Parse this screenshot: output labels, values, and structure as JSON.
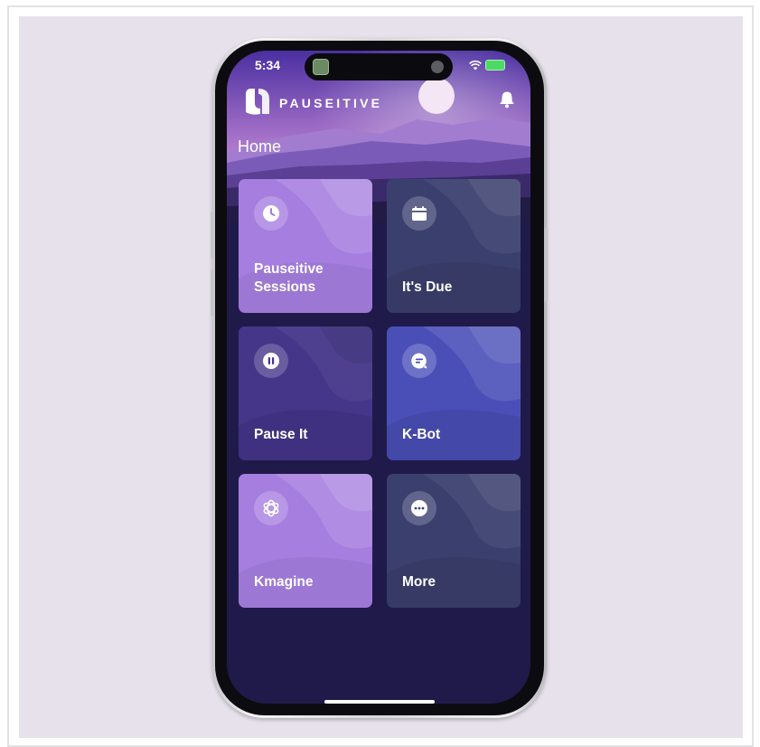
{
  "status": {
    "time": "5:34"
  },
  "header": {
    "brand": "PAUSEITIVE",
    "title": "Home"
  },
  "tiles": [
    {
      "label": "Pauseitive Sessions",
      "icon": "clock-icon",
      "color": "#a57ee0"
    },
    {
      "label": "It's Due",
      "icon": "calendar-icon",
      "color": "#3b3f6e"
    },
    {
      "label": "Pause It",
      "icon": "pause-icon",
      "color": "#45368a"
    },
    {
      "label": "K-Bot",
      "icon": "chat-icon",
      "color": "#4a4fb8"
    },
    {
      "label": "Kmagine",
      "icon": "openai-icon",
      "color": "#a57ee0"
    },
    {
      "label": "More",
      "icon": "more-icon",
      "color": "#3b3f6e"
    }
  ],
  "colors": {
    "screen_bg": "#201a4a",
    "canvas_bg": "#e7e1ec"
  }
}
